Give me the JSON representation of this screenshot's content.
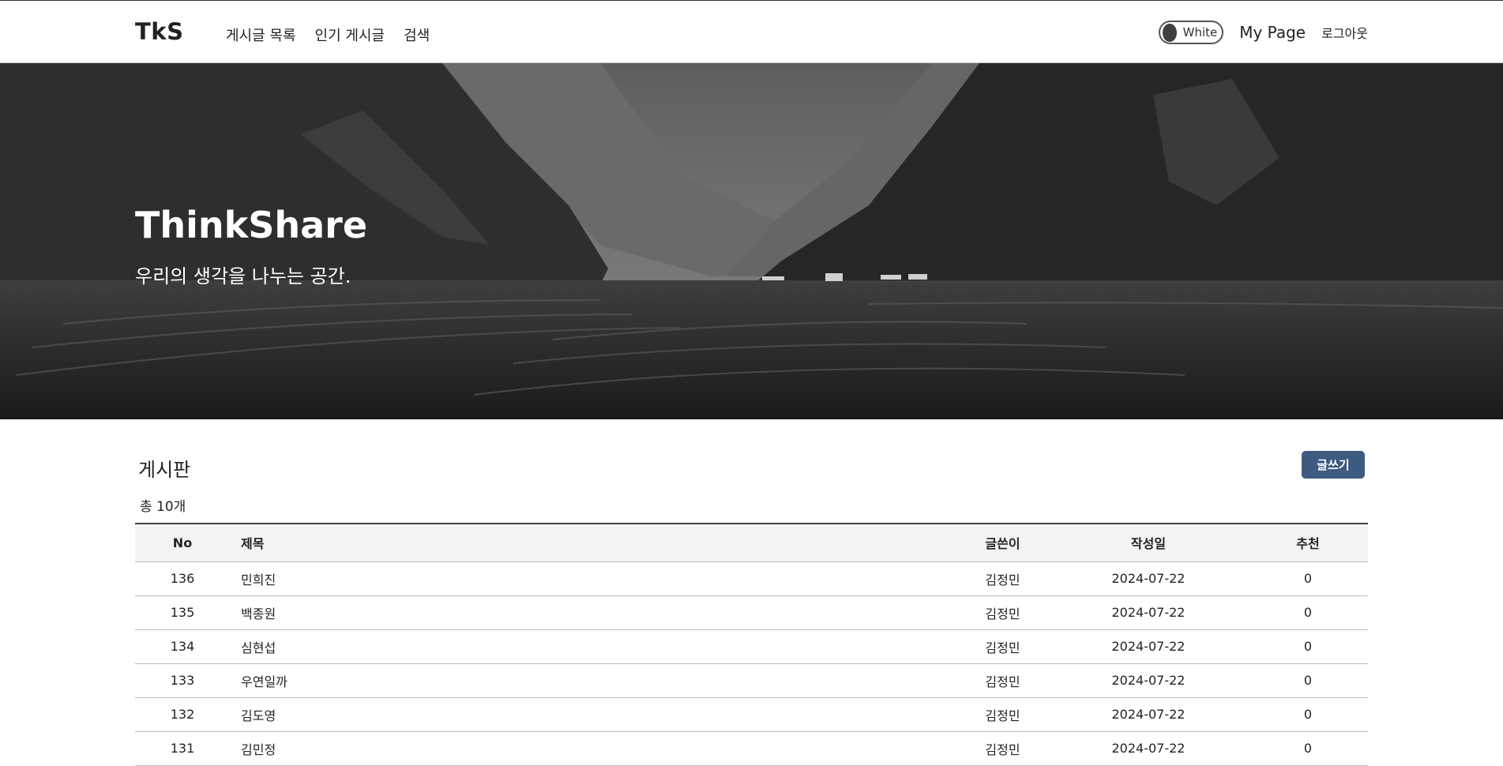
{
  "header": {
    "logo": "TkS",
    "nav": [
      "게시글 목록",
      "인기 게시글",
      "검색"
    ],
    "theme_toggle_label": "White",
    "my_page": "My Page",
    "logout": "로그아웃"
  },
  "hero": {
    "title": "ThinkShare",
    "subtitle": "우리의 생각을 나누는 공간."
  },
  "board": {
    "title": "게시판",
    "write_button": "글쓰기",
    "total": "총 10개",
    "columns": [
      "No",
      "제목",
      "글쓴이",
      "작성일",
      "추천"
    ],
    "rows": [
      {
        "no": "136",
        "title": "민희진",
        "author": "김정민",
        "date": "2024-07-22",
        "rec": "0"
      },
      {
        "no": "135",
        "title": "백종원",
        "author": "김정민",
        "date": "2024-07-22",
        "rec": "0"
      },
      {
        "no": "134",
        "title": "심현섭",
        "author": "김정민",
        "date": "2024-07-22",
        "rec": "0"
      },
      {
        "no": "133",
        "title": "우연일까",
        "author": "김정민",
        "date": "2024-07-22",
        "rec": "0"
      },
      {
        "no": "132",
        "title": "김도영",
        "author": "김정민",
        "date": "2024-07-22",
        "rec": "0"
      },
      {
        "no": "131",
        "title": "김민정",
        "author": "김정민",
        "date": "2024-07-22",
        "rec": "0"
      }
    ]
  },
  "colors": {
    "accent": "#3d5a80",
    "header_row_bg": "#f3f3f3"
  }
}
